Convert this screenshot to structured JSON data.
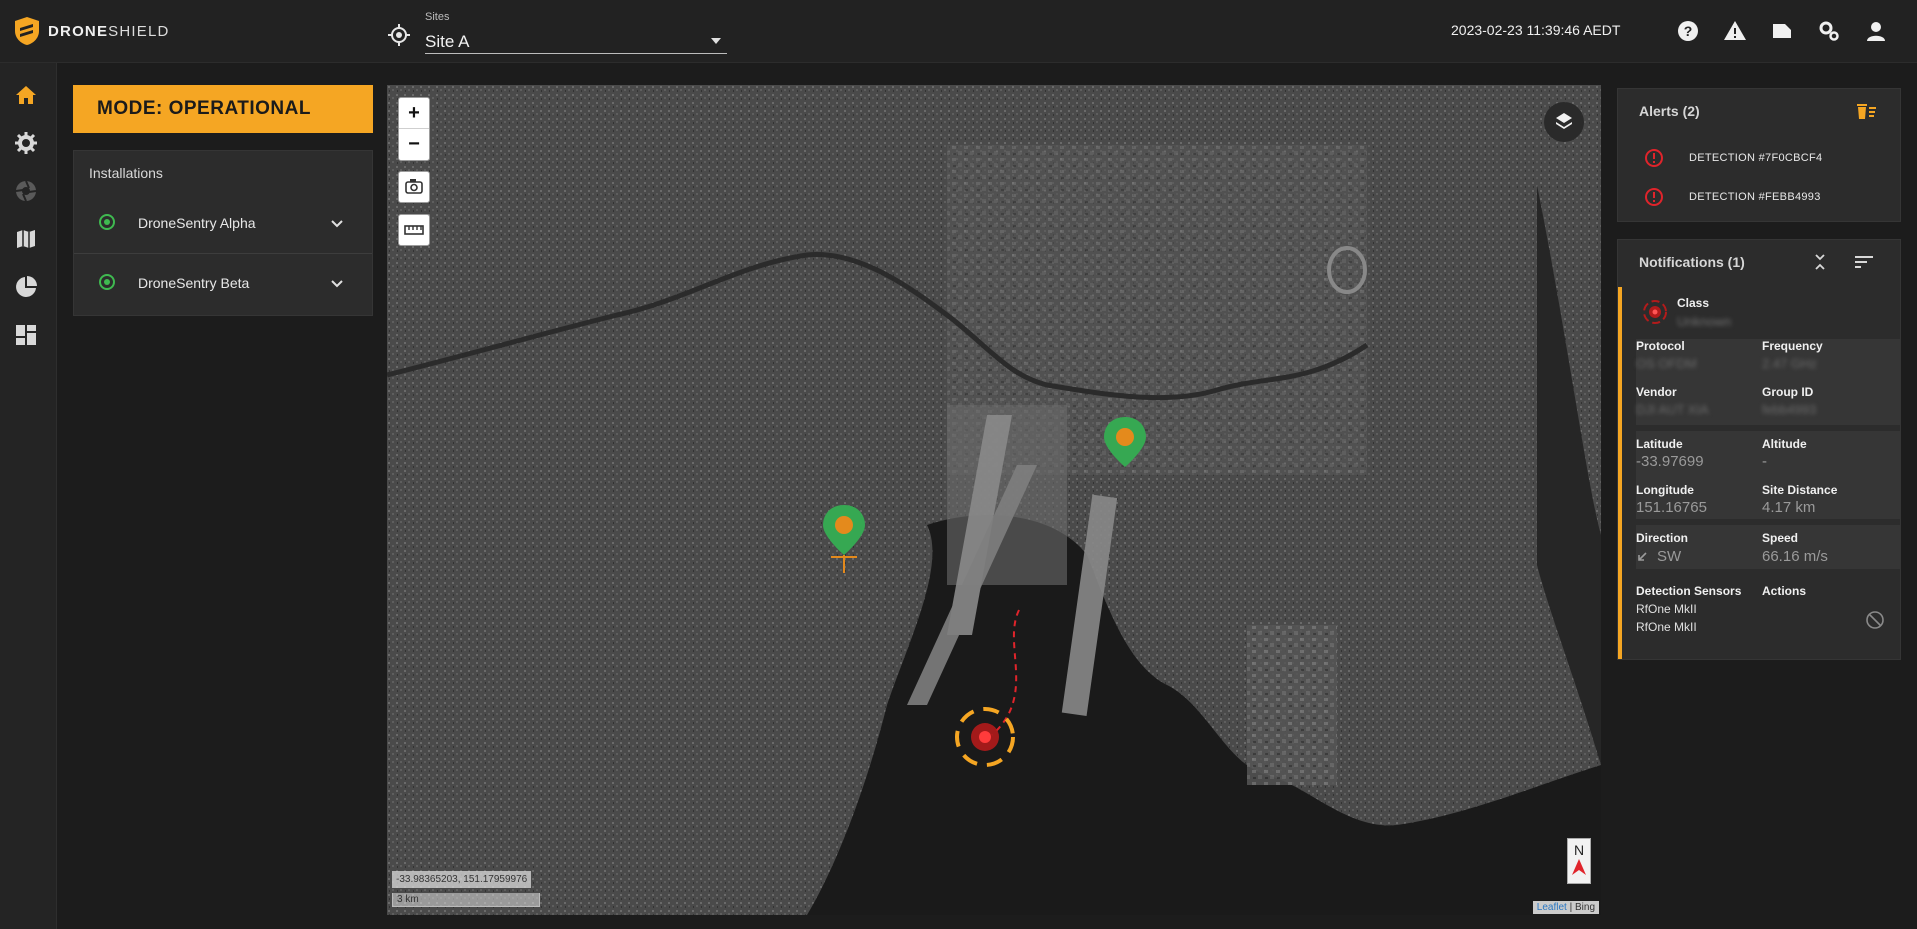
{
  "app": {
    "brand_bold": "DRONE",
    "brand_light": "SHIELD",
    "datetime": "2023-02-23 11:39:46 AEDT"
  },
  "sites": {
    "label": "Sites",
    "selected": "Site A"
  },
  "top_icons": [
    "help-icon",
    "warning-icon",
    "folder-icon",
    "settings-cog-icon",
    "account-icon"
  ],
  "nav": [
    "home-icon",
    "settings-icon",
    "aperture-icon",
    "map-icon",
    "pie-chart-icon",
    "dashboard-icon"
  ],
  "mode": {
    "label": "MODE: OPERATIONAL",
    "color": "#f5a623"
  },
  "installations": {
    "title": "Installations",
    "items": [
      {
        "name": "DroneSentry Alpha",
        "status_color": "#3fb950"
      },
      {
        "name": "DroneSentry Beta",
        "status_color": "#3fb950"
      }
    ]
  },
  "map": {
    "zoom_in": "+",
    "zoom_out": "−",
    "cursor_coords": "-33.98365203, 151.17959976",
    "scale": "3 km",
    "attribution_leaflet": "Leaflet",
    "attribution_sep": " | ",
    "attribution_bing": "Bing",
    "north": "N"
  },
  "alerts": {
    "title": "Alerts (2)",
    "items": [
      {
        "text": "DETECTION #7F0CBCF4"
      },
      {
        "text": "DETECTION #FEBB4993"
      }
    ]
  },
  "notifications": {
    "title": "Notifications (1)",
    "card": {
      "class_label": "Class",
      "class_value": "Unknown",
      "protocol_label": "Protocol",
      "protocol_value": "OS OFDM",
      "frequency_label": "Frequency",
      "frequency_value": "2.47 GHz",
      "vendor_label": "Vendor",
      "vendor_value": "DJI AUT XIA",
      "groupid_label": "Group ID",
      "groupid_value": "febb4993",
      "latitude_label": "Latitude",
      "latitude_value": "-33.97699",
      "altitude_label": "Altitude",
      "altitude_value": "-",
      "longitude_label": "Longitude",
      "longitude_value": "151.16765",
      "distance_label": "Site Distance",
      "distance_value": "4.17 km",
      "direction_label": "Direction",
      "direction_value": "SW",
      "speed_label": "Speed",
      "speed_value": "66.16 m/s",
      "sensors_label": "Detection Sensors",
      "sensors": [
        "RfOne MkII",
        "RfOne MkII"
      ],
      "actions_label": "Actions"
    }
  }
}
